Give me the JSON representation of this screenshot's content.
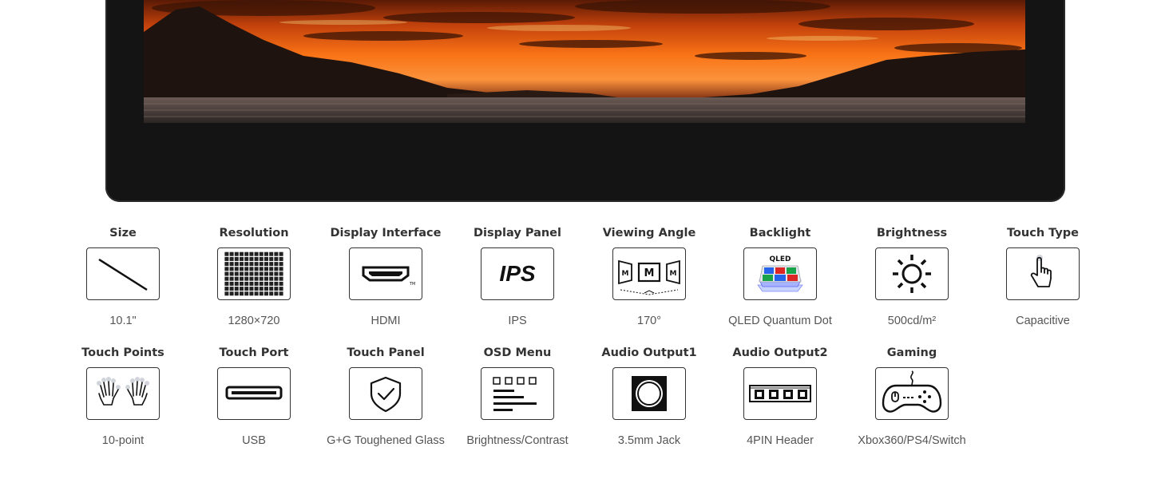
{
  "specs": [
    {
      "title": "Size",
      "value": "10.1\"",
      "icon": "diagonal-line-icon"
    },
    {
      "title": "Resolution",
      "value": "1280×720",
      "icon": "pixel-grid-icon"
    },
    {
      "title": "Display Interface",
      "value": "HDMI",
      "icon": "hdmi-port-icon",
      "tm": "TM"
    },
    {
      "title": "Display Panel",
      "value": "IPS",
      "icon": "ips-icon",
      "badge": "IPS"
    },
    {
      "title": "Viewing Angle",
      "value": "170°",
      "icon": "viewing-angle-icon",
      "glyph": "M"
    },
    {
      "title": "Backlight",
      "value": "QLED Quantum Dot",
      "icon": "qled-icon",
      "badge": "QLED"
    },
    {
      "title": "Brightness",
      "value": "500cd/m²",
      "icon": "sun-icon"
    },
    {
      "title": "Touch Type",
      "value": "Capacitive",
      "icon": "finger-touch-icon"
    },
    {
      "title": "Touch Points",
      "value": "10-point",
      "icon": "two-hands-icon"
    },
    {
      "title": "Touch Port",
      "value": "USB",
      "icon": "usb-port-icon"
    },
    {
      "title": "Touch Panel",
      "value": "G+G Toughened Glass",
      "icon": "shield-check-icon"
    },
    {
      "title": "OSD Menu",
      "value": "Brightness/Contrast",
      "icon": "osd-menu-icon"
    },
    {
      "title": "Audio Output1",
      "value": "3.5mm Jack",
      "icon": "audio-jack-icon"
    },
    {
      "title": "Audio Output2",
      "value": "4PIN Header",
      "icon": "pin-header-icon"
    },
    {
      "title": "Gaming",
      "value": "Xbox360/PS4/Switch",
      "icon": "gamepad-icon"
    }
  ]
}
